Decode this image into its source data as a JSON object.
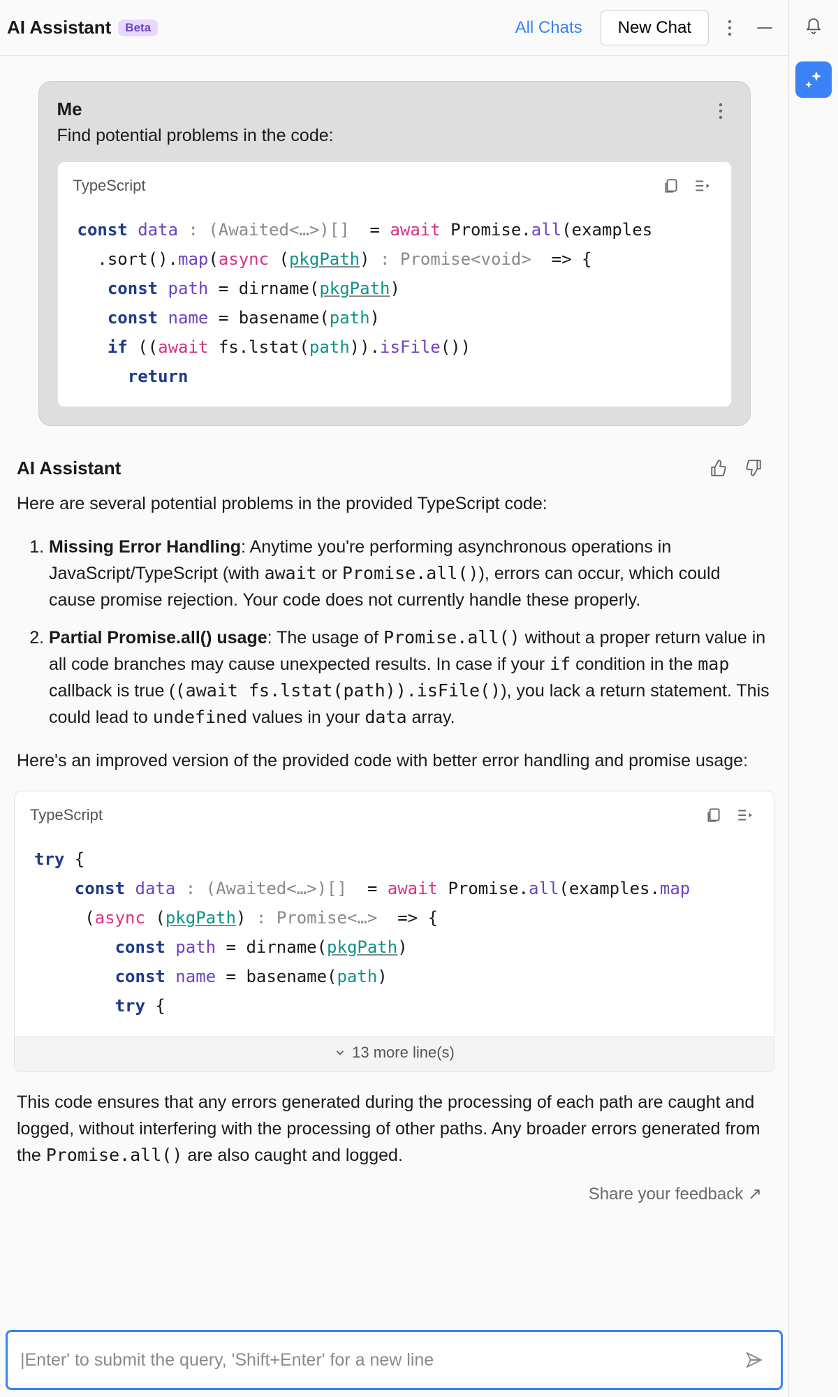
{
  "header": {
    "title": "AI Assistant",
    "badge": "Beta",
    "all_chats": "All Chats",
    "new_chat": "New Chat"
  },
  "user_message": {
    "sender": "Me",
    "text": "Find potential problems in the code:"
  },
  "user_code": {
    "language": "TypeScript",
    "tokens": {
      "l1_const": "const",
      "l1_data": "data",
      "l1_type": " : (Awaited<…>)[]  ",
      "l1_eq": "= ",
      "l1_await": "await",
      "l1_prom": " Promise.",
      "l1_all": "all",
      "l1_open": "(examples",
      "l2_sort": "  .sort().",
      "l2_map": "map",
      "l2_p1": "(",
      "l2_async": "async",
      "l2_p2": " (",
      "l2_pkg": "pkgPath",
      "l2_p3": ")",
      "l2_type": " : Promise<void>  ",
      "l2_arrow": "=> {",
      "l3_const": "const",
      "l3_path": " path",
      "l3_eq": " = dirname(",
      "l3_pkg": "pkgPath",
      "l3_close": ")",
      "l4_const": "const",
      "l4_name": " name",
      "l4_eq": " = basename(",
      "l4_path": "path",
      "l4_close": ")",
      "l5_if": "if",
      "l5_open": " ((",
      "l5_await": "await",
      "l5_fs": " fs.lstat(",
      "l5_path": "path",
      "l5_mid": ")).",
      "l5_isfile": "isFile",
      "l5_close": "())",
      "l6_return": "return"
    }
  },
  "assistant": {
    "name": "AI Assistant",
    "intro": "Here are several potential problems in the provided TypeScript code:",
    "items": [
      {
        "bold": "Missing Error Handling",
        "rest_a": ": Anytime you're performing asynchronous operations in JavaScript/TypeScript (with ",
        "mono_a": "await",
        "rest_b": " or ",
        "mono_b": "Promise.all()",
        "rest_c": "), errors can occur, which could cause promise rejection. Your code does not currently handle these properly."
      },
      {
        "bold": "Partial Promise.all() usage",
        "rest_a": ": The usage of ",
        "mono_a": "Promise.all()",
        "rest_b": " without a proper return value in all code branches may cause unexpected results. In case if your ",
        "mono_b": "if",
        "rest_c": " condition in the ",
        "mono_c": "map",
        "rest_d": " callback is true (",
        "mono_d": "(await fs.lstat(path)).isFile()",
        "rest_e": "), you lack a return statement. This could lead to ",
        "mono_e": "undefined",
        "rest_f": " values in your ",
        "mono_f": "data",
        "rest_g": " array."
      }
    ],
    "improved_intro": "Here's an improved version of the provided code with better error handling and promise usage:"
  },
  "assistant_code": {
    "language": "TypeScript",
    "more_lines": "13 more line(s)",
    "tokens": {
      "l1_try": "try",
      "l1_brace": " {",
      "l2_const": "const",
      "l2_data": " data",
      "l2_type": " : (Awaited<…>)[]  ",
      "l2_eq": "= ",
      "l2_await": "await",
      "l2_prom": " Promise.",
      "l2_all": "all",
      "l2_open": "(examples.",
      "l2_map": "map",
      "l3_open": "(",
      "l3_async": "async",
      "l3_p2": " (",
      "l3_pkg": "pkgPath",
      "l3_p3": ")",
      "l3_type": " : Promise<…>  ",
      "l3_arrow": "=> {",
      "l4_const": "const",
      "l4_path": " path",
      "l4_eq": " = dirname(",
      "l4_pkg": "pkgPath",
      "l4_close": ")",
      "l5_const": "const",
      "l5_name": " name",
      "l5_eq": " = basename(",
      "l5_path": "path",
      "l5_close": ")",
      "l6_try": "try",
      "l6_brace": " {"
    }
  },
  "closing_a": "This code ensures that any errors generated during the processing of each path are caught and logged, without interfering with the processing of other paths. Any broader errors generated from the ",
  "closing_mono": "Promise.all()",
  "closing_b": " are also caught and logged.",
  "feedback_link": "Share your feedback ↗",
  "input": {
    "placeholder": "|Enter' to submit the query, 'Shift+Enter' for a new line"
  }
}
